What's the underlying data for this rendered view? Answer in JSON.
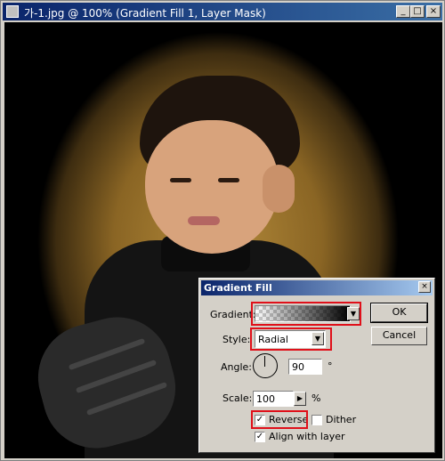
{
  "window": {
    "title": "가-1.jpg @ 100% (Gradient Fill 1, Layer Mask)",
    "minimize_glyph": "_",
    "maximize_glyph": "□",
    "close_glyph": "×"
  },
  "dialog": {
    "title": "Gradient Fill",
    "close_glyph": "×",
    "gradient_label": "Gradient:",
    "style_label": "Style:",
    "style_value": "Radial",
    "angle_label": "Angle:",
    "angle_value": "90",
    "angle_unit": "°",
    "scale_label": "Scale:",
    "scale_value": "100",
    "scale_unit": "%",
    "reverse_label": "Reverse",
    "reverse_checked": true,
    "dither_label": "Dither",
    "dither_checked": false,
    "align_label": "Align with layer",
    "align_checked": true,
    "ok_label": "OK",
    "cancel_label": "Cancel",
    "dropdown_glyph": "▼",
    "arrow_glyph": "▶",
    "check_glyph": "✓"
  },
  "colors": {
    "highlight": "#e0101a",
    "title_active": "#0a246a"
  }
}
